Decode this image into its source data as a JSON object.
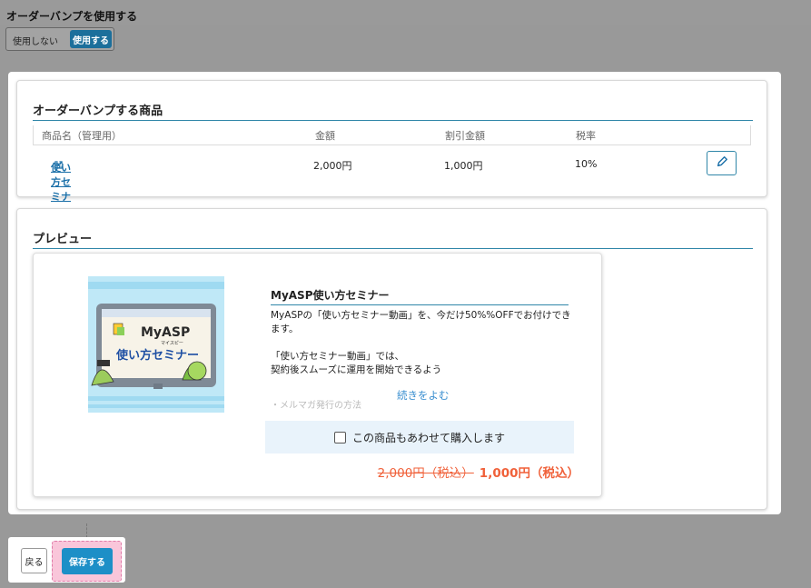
{
  "header": {
    "title": "オーダーバンプを使用する",
    "toggle_off_label": "使用しない",
    "toggle_on_label": "使用する"
  },
  "bump_section": {
    "title": "オーダーバンプする商品",
    "columns": [
      "商品名（管理用）",
      "金額",
      "割引金額",
      "税率"
    ],
    "rows": [
      {
        "name": "使い方セミナー（割引あり）",
        "price": "2,000円",
        "discount": "1,000円",
        "tax": "10%"
      }
    ]
  },
  "preview": {
    "title": "プレビュー",
    "product_title": "MyASP使い方セミナー",
    "description": [
      "MyASPの「使い方セミナー動画」を、今だけ50%%OFFでお付けできます。",
      "",
      "「使い方セミナー動画」では、",
      "契約後スムーズに運用を開始できるよう"
    ],
    "faded_text": "・メルマガ発行の方法",
    "read_more": "続きをよむ",
    "checkbox_label": "この商品もあわせて購入します",
    "old_price": "2,000円（税込）",
    "new_price": "1,000円（税込）",
    "thumbnail": {
      "logo_text": "MyASP",
      "logo_sub": "マイスピー",
      "caption": "使い方セミナー"
    }
  },
  "footer": {
    "back_label": "戻る",
    "save_label": "保存する"
  },
  "colors": {
    "accent": "#1d8fc7",
    "link": "#1a6fa8",
    "price": "#f0613a",
    "buybox_bg": "#e9f3fb"
  }
}
